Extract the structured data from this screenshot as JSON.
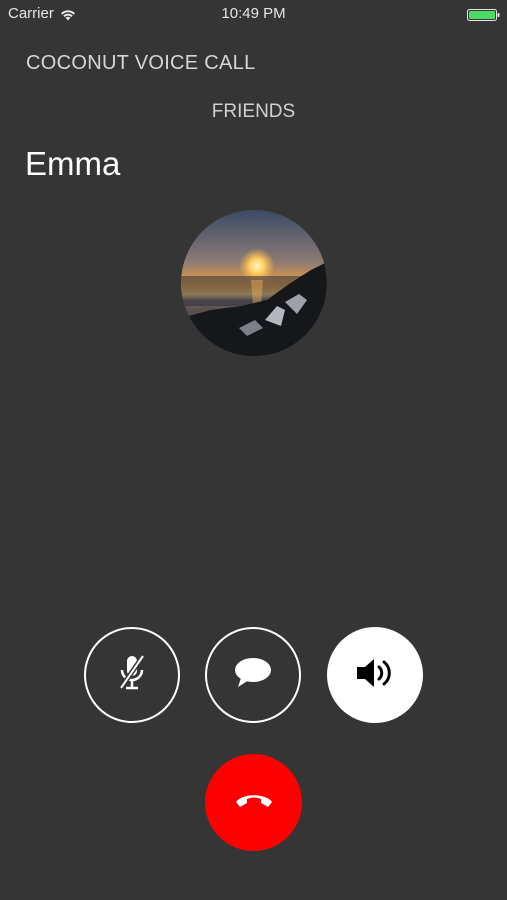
{
  "status_bar": {
    "carrier": "Carrier",
    "time": "10:49 PM",
    "battery_level": 1.0,
    "battery_color": "#4cd964"
  },
  "app": {
    "title": "COCONUT VOICE CALL"
  },
  "call": {
    "group": "FRIENDS",
    "contact_name": "Emma",
    "avatar_icon": "sunset-photo-avatar"
  },
  "controls": {
    "mute_icon": "microphone-muted-icon",
    "message_icon": "chat-bubble-icon",
    "speaker_icon": "speaker-icon",
    "speaker_active": true,
    "hangup_icon": "phone-hangup-icon",
    "hangup_color": "#ff0000"
  },
  "colors": {
    "background": "#353535",
    "foreground": "#ffffff"
  }
}
